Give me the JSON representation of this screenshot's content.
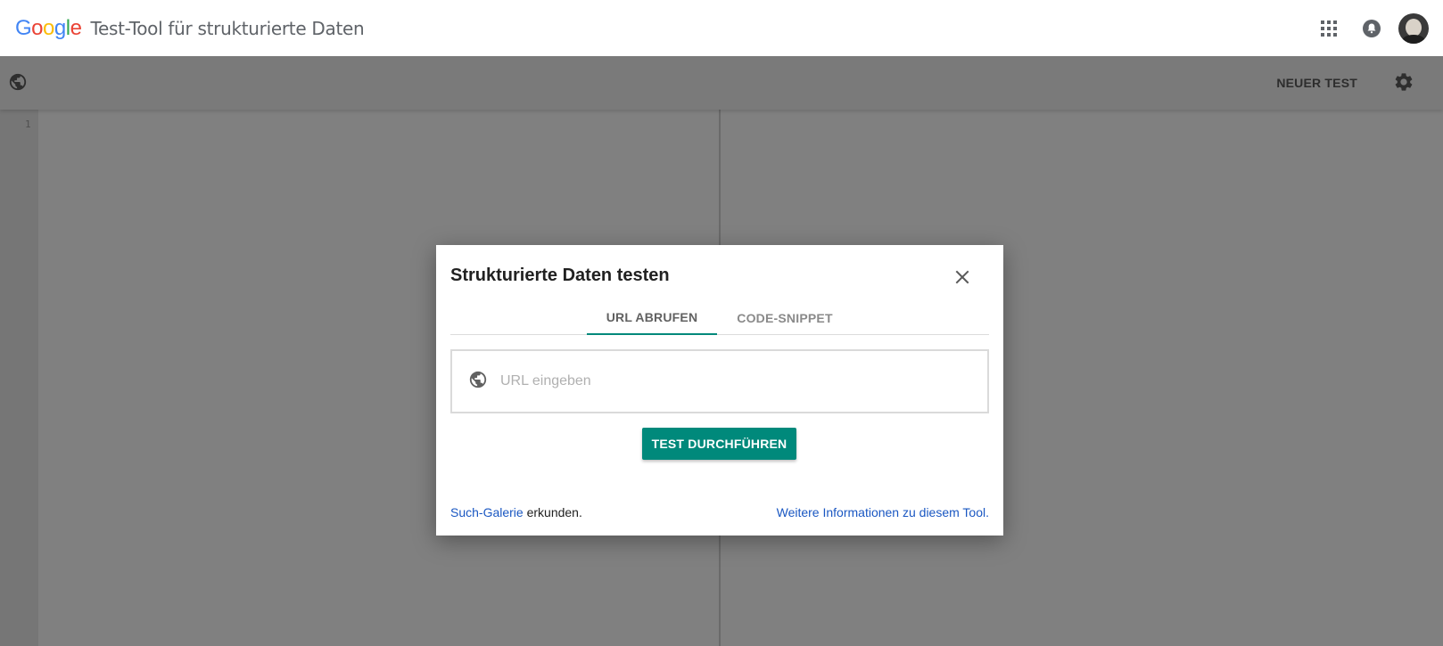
{
  "header": {
    "logo_letters": [
      "G",
      "o",
      "o",
      "g",
      "l",
      "e"
    ],
    "logo_colors": [
      "#4285F4",
      "#EA4335",
      "#FBBC05",
      "#4285F4",
      "#34A853",
      "#EA4335"
    ],
    "app_title": "Test-Tool für strukturierte Daten",
    "icons": [
      "apps-icon",
      "notifications-icon",
      "avatar"
    ]
  },
  "toolbar": {
    "new_test_label": "NEUER TEST",
    "icons": [
      "globe-icon",
      "gear-icon"
    ]
  },
  "editor": {
    "line_numbers": [
      "1"
    ]
  },
  "dialog": {
    "title": "Strukturierte Daten testen",
    "tabs": [
      {
        "label": "URL ABRUFEN",
        "active": true
      },
      {
        "label": "CODE-SNIPPET",
        "active": false
      }
    ],
    "url_input": {
      "value": "",
      "placeholder": "URL eingeben"
    },
    "run_button_label": "TEST DURCHFÜHREN",
    "footer_left_link": "Such-Galerie",
    "footer_left_text": " erkunden.",
    "footer_right_link": "Weitere Informationen zu diesem Tool."
  },
  "colors": {
    "accent": "#00897b",
    "link": "#1a57c2",
    "overlay": "#808080"
  }
}
